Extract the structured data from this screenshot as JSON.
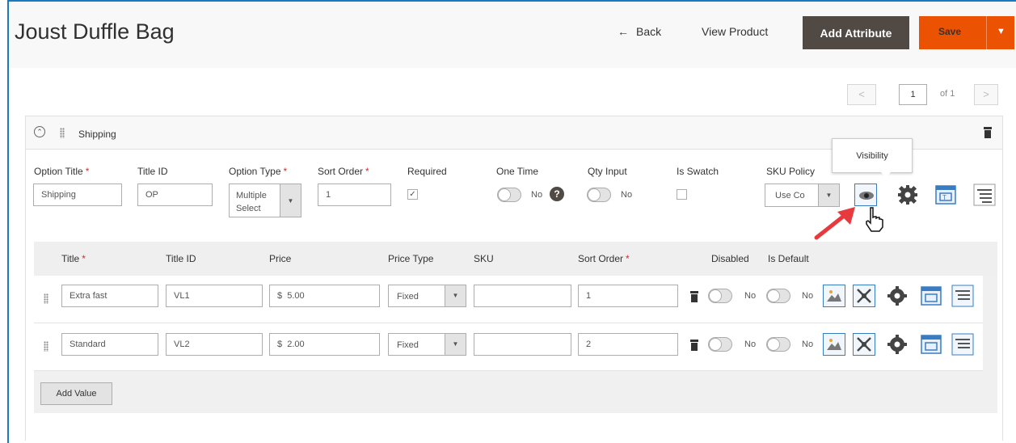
{
  "header": {
    "title": "Joust Duffle Bag",
    "back_label": "Back",
    "view_product_label": "View Product",
    "add_attribute_label": "Add Attribute",
    "save_label": "Save"
  },
  "pager": {
    "current": "1",
    "of_label": "of 1"
  },
  "section": {
    "title": "Shipping"
  },
  "option_form": {
    "labels": {
      "option_title": "Option Title",
      "title_id": "Title ID",
      "option_type": "Option Type",
      "sort_order": "Sort Order",
      "required": "Required",
      "one_time": "One Time",
      "qty_input": "Qty Input",
      "is_swatch": "Is Swatch",
      "sku_policy": "SKU Policy"
    },
    "values": {
      "option_title": "Shipping",
      "title_id": "OP",
      "option_type_line1": "Multiple",
      "option_type_line2": "Select",
      "sort_order": "1",
      "one_time": "No",
      "qty_input": "No",
      "sku_policy": "Use Co"
    },
    "required_marker": "*"
  },
  "tooltip": {
    "text": "Visibility"
  },
  "values_table": {
    "headers": {
      "title": "Title",
      "title_id": "Title ID",
      "price": "Price",
      "price_type": "Price Type",
      "sku": "SKU",
      "sort_order": "Sort Order",
      "disabled": "Disabled",
      "is_default": "Is Default"
    },
    "rows": [
      {
        "title": "Extra fast",
        "title_id": "VL1",
        "price_symbol": "$",
        "price": "5.00",
        "price_type": "Fixed",
        "sku": "",
        "sort_order": "1",
        "disabled": "No",
        "is_default": "No"
      },
      {
        "title": "Standard",
        "title_id": "VL2",
        "price_symbol": "$",
        "price": "2.00",
        "price_type": "Fixed",
        "sku": "",
        "sort_order": "2",
        "disabled": "No",
        "is_default": "No"
      }
    ],
    "add_value_label": "Add Value"
  },
  "colors": {
    "accent_orange": "#eb5202",
    "dark_button": "#514943",
    "frame_blue": "#1979c3",
    "required_red": "#e22626",
    "arrow_red": "#e8393e"
  }
}
